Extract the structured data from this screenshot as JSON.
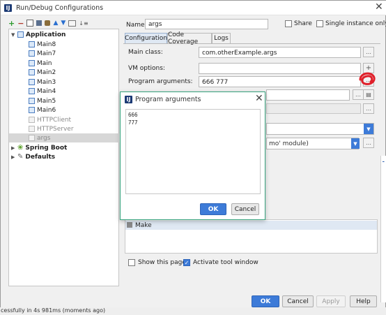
{
  "window": {
    "title": "Run/Debug Configurations"
  },
  "toolbar": {
    "icons": [
      "add-icon",
      "remove-icon",
      "copy-icon",
      "save-icon",
      "edit-defaults-icon",
      "move-up-icon",
      "move-down-icon",
      "folder-icon",
      "sort-icon"
    ]
  },
  "tree": {
    "application": {
      "label": "Application"
    },
    "items": [
      {
        "label": "Main8"
      },
      {
        "label": "Main7"
      },
      {
        "label": "Main"
      },
      {
        "label": "Main2"
      },
      {
        "label": "Main3"
      },
      {
        "label": "Main4"
      },
      {
        "label": "Main5"
      },
      {
        "label": "Main6"
      },
      {
        "label": "HTTPClient"
      },
      {
        "label": "HTTPServer"
      },
      {
        "label": "args"
      }
    ],
    "spring_boot": {
      "label": "Spring Boot"
    },
    "defaults": {
      "label": "Defaults"
    }
  },
  "header": {
    "name_label": "Name:",
    "name_value": "args",
    "share_label": "Share",
    "single_instance_label": "Single instance only"
  },
  "tabs": [
    {
      "label": "Configuration"
    },
    {
      "label": "Code Coverage"
    },
    {
      "label": "Logs"
    }
  ],
  "form": {
    "main_class_label": "Main class:",
    "main_class_value": "com.otherExample.args",
    "vm_options_label": "VM options:",
    "vm_options_value": "",
    "program_arguments_label": "Program arguments:",
    "program_arguments_value": "666 777",
    "module_partial": "mo' module)"
  },
  "popup": {
    "title": "Program arguments",
    "text": "666\n777",
    "ok_label": "OK",
    "cancel_label": "Cancel"
  },
  "before_launch": {
    "item_label": "Make",
    "show_page_label": "Show this page",
    "activate_tool_window_label": "Activate tool window"
  },
  "buttons": {
    "ok": "OK",
    "cancel": "Cancel",
    "apply": "Apply",
    "help": "Help"
  },
  "status": {
    "text": "cessfully in 4s 981ms (moments ago)"
  },
  "colors": {
    "accent": "#3d7bd8",
    "popup_border": "#37a37e",
    "annotation": "#e0202a"
  }
}
